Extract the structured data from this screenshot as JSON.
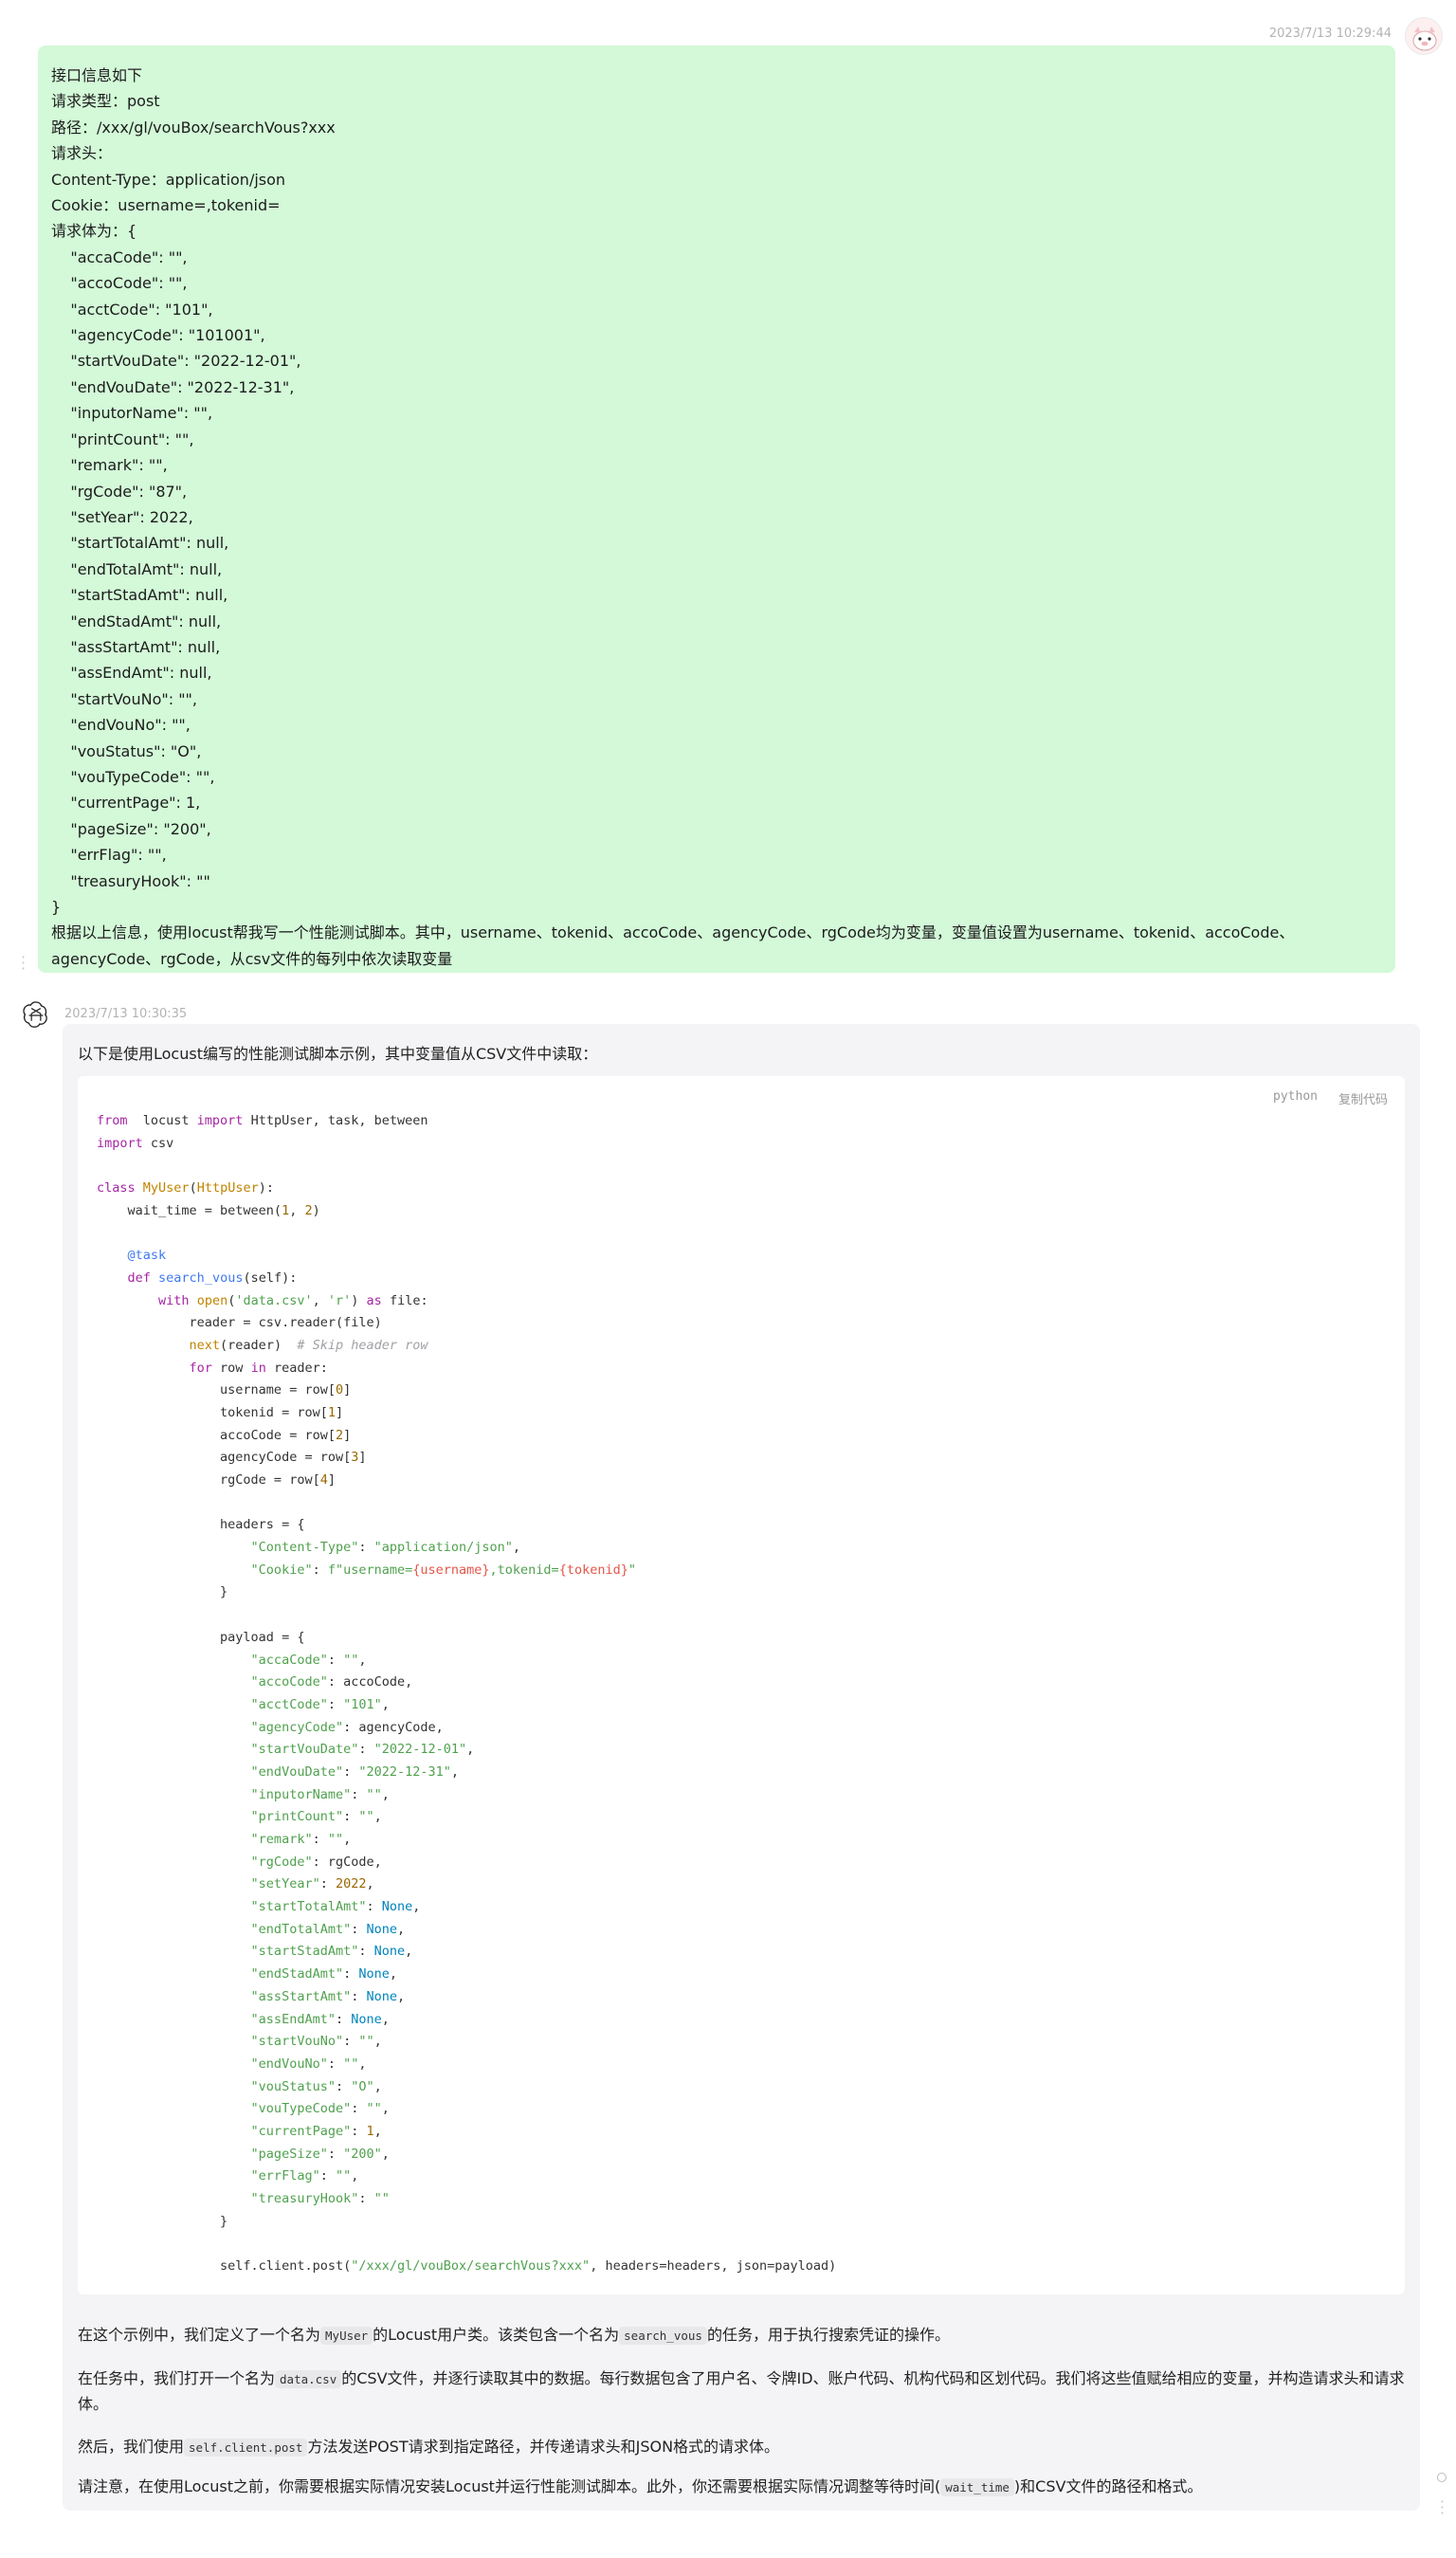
{
  "user_message": {
    "timestamp": "2023/7/13 10:29:44",
    "lines": [
      "接口信息如下",
      "请求类型：post",
      "路径：/xxx/gl/vouBox/searchVous?xxx",
      "请求头：",
      "Content-Type：application/json",
      "Cookie：username=,tokenid=",
      "请求体为：{",
      "    \"accaCode\": \"\",",
      "    \"accoCode\": \"\",",
      "    \"acctCode\": \"101\",",
      "    \"agencyCode\": \"101001\",",
      "    \"startVouDate\": \"2022-12-01\",",
      "    \"endVouDate\": \"2022-12-31\",",
      "    \"inputorName\": \"\",",
      "    \"printCount\": \"\",",
      "    \"remark\": \"\",",
      "    \"rgCode\": \"87\",",
      "    \"setYear\": 2022,",
      "    \"startTotalAmt\": null,",
      "    \"endTotalAmt\": null,",
      "    \"startStadAmt\": null,",
      "    \"endStadAmt\": null,",
      "    \"assStartAmt\": null,",
      "    \"assEndAmt\": null,",
      "    \"startVouNo\": \"\",",
      "    \"endVouNo\": \"\",",
      "    \"vouStatus\": \"O\",",
      "    \"vouTypeCode\": \"\",",
      "    \"currentPage\": 1,",
      "    \"pageSize\": \"200\",",
      "    \"errFlag\": \"\",",
      "    \"treasuryHook\": \"\"",
      "}"
    ],
    "final_paragraph": "根据以上信息，使用locust帮我写一个性能测试脚本。其中，username、tokenid、accoCode、agencyCode、rgCode均为变量，变量值设置为username、tokenid、accoCode、agencyCode、rgCode，从csv文件的每列中依次读取变量"
  },
  "bot_message": {
    "timestamp": "2023/7/13 10:30:35",
    "intro": "以下是使用Locust编写的性能测试脚本示例，其中变量值从CSV文件中读取：",
    "code_language": "python",
    "copy_label": "复制代码",
    "code_lines": [
      [
        [
          "kw",
          "from"
        ],
        [
          "",
          "  locust "
        ],
        [
          "kw",
          "import"
        ],
        [
          "",
          " HttpUser, task, between"
        ]
      ],
      [
        [
          "kw",
          "import"
        ],
        [
          "",
          " csv"
        ]
      ],
      [],
      [
        [
          "kw",
          "class"
        ],
        [
          "",
          " "
        ],
        [
          "cls",
          "MyUser"
        ],
        [
          "",
          "("
        ],
        [
          "cls",
          "HttpUser"
        ],
        [
          "",
          "):"
        ]
      ],
      [
        [
          "",
          "    wait_time = between("
        ],
        [
          "num",
          "1"
        ],
        [
          "",
          ", "
        ],
        [
          "num",
          "2"
        ],
        [
          "",
          ")"
        ]
      ],
      [],
      [
        [
          "dec",
          "    @task"
        ]
      ],
      [
        [
          "kw",
          "    def"
        ],
        [
          "",
          " "
        ],
        [
          "fn",
          "search_vous"
        ],
        [
          "",
          "(self):"
        ]
      ],
      [
        [
          "kw",
          "        with"
        ],
        [
          "",
          " "
        ],
        [
          "bi",
          "open"
        ],
        [
          "",
          "("
        ],
        [
          "str",
          "'data.csv'"
        ],
        [
          "",
          ", "
        ],
        [
          "str",
          "'r'"
        ],
        [
          "",
          ") "
        ],
        [
          "kw",
          "as"
        ],
        [
          "",
          " file:"
        ]
      ],
      [
        [
          "",
          "            reader = csv.reader(file)"
        ]
      ],
      [
        [
          "bi",
          "            next"
        ],
        [
          "",
          "(reader)  "
        ],
        [
          "cmt",
          "# Skip header row"
        ]
      ],
      [
        [
          "kw",
          "            for"
        ],
        [
          "",
          " row "
        ],
        [
          "kw",
          "in"
        ],
        [
          "",
          " reader:"
        ]
      ],
      [
        [
          "",
          "                username = row["
        ],
        [
          "num",
          "0"
        ],
        [
          "",
          "]"
        ]
      ],
      [
        [
          "",
          "                tokenid = row["
        ],
        [
          "num",
          "1"
        ],
        [
          "",
          "]"
        ]
      ],
      [
        [
          "",
          "                accoCode = row["
        ],
        [
          "num",
          "2"
        ],
        [
          "",
          "]"
        ]
      ],
      [
        [
          "",
          "                agencyCode = row["
        ],
        [
          "num",
          "3"
        ],
        [
          "",
          "]"
        ]
      ],
      [
        [
          "",
          "                rgCode = row["
        ],
        [
          "num",
          "4"
        ],
        [
          "",
          "]"
        ]
      ],
      [],
      [
        [
          "",
          "                headers = {"
        ]
      ],
      [
        [
          "str",
          "                    \"Content-Type\""
        ],
        [
          "",
          ": "
        ],
        [
          "str",
          "\"application/json\""
        ],
        [
          "",
          ","
        ]
      ],
      [
        [
          "str",
          "                    \"Cookie\""
        ],
        [
          "",
          ": "
        ],
        [
          "str",
          "f\"username="
        ],
        [
          "ptr",
          "{username}"
        ],
        [
          "str",
          ",tokenid="
        ],
        [
          "ptr",
          "{tokenid}"
        ],
        [
          "str",
          "\""
        ]
      ],
      [
        [
          "",
          "                }"
        ]
      ],
      [],
      [
        [
          "",
          "                payload = {"
        ]
      ],
      [
        [
          "str",
          "                    \"accaCode\""
        ],
        [
          "",
          ": "
        ],
        [
          "str",
          "\"\""
        ],
        [
          "",
          ","
        ]
      ],
      [
        [
          "str",
          "                    \"accoCode\""
        ],
        [
          "",
          ": accoCode,"
        ]
      ],
      [
        [
          "str",
          "                    \"acctCode\""
        ],
        [
          "",
          ": "
        ],
        [
          "str",
          "\"101\""
        ],
        [
          "",
          ","
        ]
      ],
      [
        [
          "str",
          "                    \"agencyCode\""
        ],
        [
          "",
          ": agencyCode,"
        ]
      ],
      [
        [
          "str",
          "                    \"startVouDate\""
        ],
        [
          "",
          ": "
        ],
        [
          "str",
          "\"2022-12-01\""
        ],
        [
          "",
          ","
        ]
      ],
      [
        [
          "str",
          "                    \"endVouDate\""
        ],
        [
          "",
          ": "
        ],
        [
          "str",
          "\"2022-12-31\""
        ],
        [
          "",
          ","
        ]
      ],
      [
        [
          "str",
          "                    \"inputorName\""
        ],
        [
          "",
          ": "
        ],
        [
          "str",
          "\"\""
        ],
        [
          "",
          ","
        ]
      ],
      [
        [
          "str",
          "                    \"printCount\""
        ],
        [
          "",
          ": "
        ],
        [
          "str",
          "\"\""
        ],
        [
          "",
          ","
        ]
      ],
      [
        [
          "str",
          "                    \"remark\""
        ],
        [
          "",
          ": "
        ],
        [
          "str",
          "\"\""
        ],
        [
          "",
          ","
        ]
      ],
      [
        [
          "str",
          "                    \"rgCode\""
        ],
        [
          "",
          ": rgCode,"
        ]
      ],
      [
        [
          "str",
          "                    \"setYear\""
        ],
        [
          "",
          ": "
        ],
        [
          "num",
          "2022"
        ],
        [
          "",
          ","
        ]
      ],
      [
        [
          "str",
          "                    \"startTotalAmt\""
        ],
        [
          "",
          ": "
        ],
        [
          "cst",
          "None"
        ],
        [
          "",
          ","
        ]
      ],
      [
        [
          "str",
          "                    \"endTotalAmt\""
        ],
        [
          "",
          ": "
        ],
        [
          "cst",
          "None"
        ],
        [
          "",
          ","
        ]
      ],
      [
        [
          "str",
          "                    \"startStadAmt\""
        ],
        [
          "",
          ": "
        ],
        [
          "cst",
          "None"
        ],
        [
          "",
          ","
        ]
      ],
      [
        [
          "str",
          "                    \"endStadAmt\""
        ],
        [
          "",
          ": "
        ],
        [
          "cst",
          "None"
        ],
        [
          "",
          ","
        ]
      ],
      [
        [
          "str",
          "                    \"assStartAmt\""
        ],
        [
          "",
          ": "
        ],
        [
          "cst",
          "None"
        ],
        [
          "",
          ","
        ]
      ],
      [
        [
          "str",
          "                    \"assEndAmt\""
        ],
        [
          "",
          ": "
        ],
        [
          "cst",
          "None"
        ],
        [
          "",
          ","
        ]
      ],
      [
        [
          "str",
          "                    \"startVouNo\""
        ],
        [
          "",
          ": "
        ],
        [
          "str",
          "\"\""
        ],
        [
          "",
          ","
        ]
      ],
      [
        [
          "str",
          "                    \"endVouNo\""
        ],
        [
          "",
          ": "
        ],
        [
          "str",
          "\"\""
        ],
        [
          "",
          ","
        ]
      ],
      [
        [
          "str",
          "                    \"vouStatus\""
        ],
        [
          "",
          ": "
        ],
        [
          "str",
          "\"O\""
        ],
        [
          "",
          ","
        ]
      ],
      [
        [
          "str",
          "                    \"vouTypeCode\""
        ],
        [
          "",
          ": "
        ],
        [
          "str",
          "\"\""
        ],
        [
          "",
          ","
        ]
      ],
      [
        [
          "str",
          "                    \"currentPage\""
        ],
        [
          "",
          ": "
        ],
        [
          "num",
          "1"
        ],
        [
          "",
          ","
        ]
      ],
      [
        [
          "str",
          "                    \"pageSize\""
        ],
        [
          "",
          ": "
        ],
        [
          "str",
          "\"200\""
        ],
        [
          "",
          ","
        ]
      ],
      [
        [
          "str",
          "                    \"errFlag\""
        ],
        [
          "",
          ": "
        ],
        [
          "str",
          "\"\""
        ],
        [
          "",
          ","
        ]
      ],
      [
        [
          "str",
          "                    \"treasuryHook\""
        ],
        [
          "",
          ": "
        ],
        [
          "str",
          "\"\""
        ]
      ],
      [
        [
          "",
          "                }"
        ]
      ],
      [],
      [
        [
          "",
          "                self.client.post("
        ],
        [
          "str",
          "\"/xxx/gl/vouBox/searchVous?xxx\""
        ],
        [
          "",
          ", headers=headers, json=payload)"
        ]
      ]
    ],
    "para1": {
      "a": "在这个示例中，我们定义了一个名为",
      "code1": "MyUser",
      "b": "的Locust用户类。该类包含一个名为",
      "code2": "search_vous",
      "c": "的任务，用于执行搜索凭证的操作。"
    },
    "para2": {
      "a": "在任务中，我们打开一个名为",
      "code1": "data.csv",
      "b": "的CSV文件，并逐行读取其中的数据。每行数据包含了用户名、令牌ID、账户代码、机构代码和区划代码。我们将这些值赋给相应的变量，并构造请求头和请求体。"
    },
    "para3": {
      "a": "然后，我们使用",
      "code1": "self.client.post",
      "b": "方法发送POST请求到指定路径，并传递请求头和JSON格式的请求体。"
    },
    "para4": {
      "a": "请注意，在使用Locust之前，你需要根据实际情况安装Locust并运行性能测试脚本。此外，你还需要根据实际情况调整等待时间(",
      "code1": "wait_time",
      "b": ")和CSV文件的路径和格式。"
    }
  }
}
